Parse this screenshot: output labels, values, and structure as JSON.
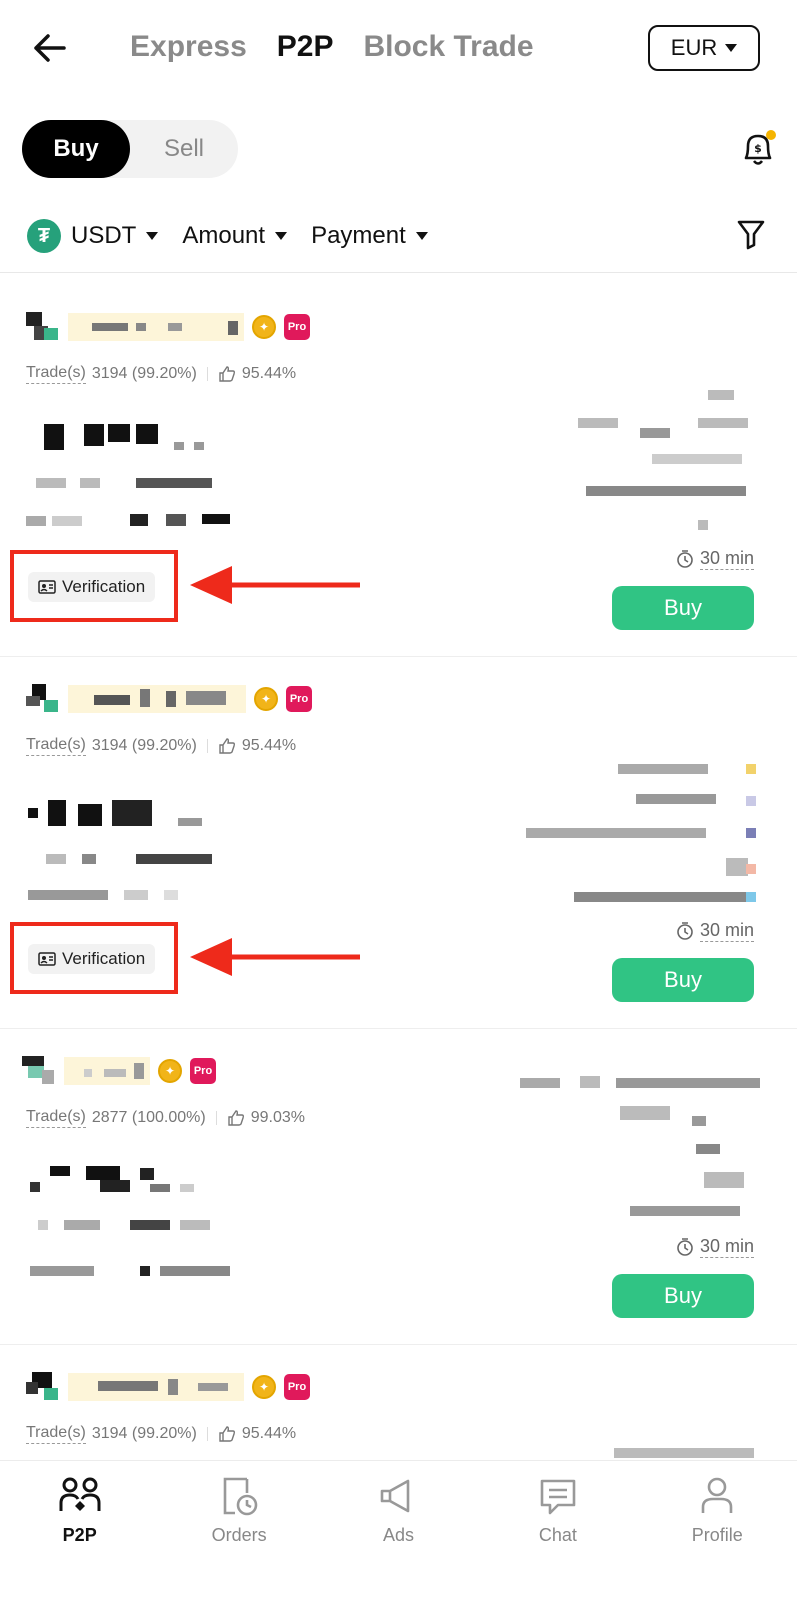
{
  "header": {
    "tabs": [
      "Express",
      "P2P",
      "Block Trade"
    ],
    "active_tab": "P2P",
    "currency": "EUR"
  },
  "toggle": {
    "buy": "Buy",
    "sell": "Sell",
    "active": "Buy"
  },
  "filters": {
    "coin": "USDT",
    "amount": "Amount",
    "payment": "Payment"
  },
  "cards": [
    {
      "trades_label": "Trade(s)",
      "trades": "3194 (99.20%)",
      "rating": "95.44%",
      "time": "30 min",
      "badge": "Verification",
      "buy": "Buy"
    },
    {
      "trades_label": "Trade(s)",
      "trades": "3194 (99.20%)",
      "rating": "95.44%",
      "time": "30 min",
      "badge": "Verification",
      "buy": "Buy"
    },
    {
      "trades_label": "Trade(s)",
      "trades": "2877 (100.00%)",
      "rating": "99.03%",
      "time": "30 min",
      "buy": "Buy"
    },
    {
      "trades_label": "Trade(s)",
      "trades": "3194 (99.20%)",
      "rating": "95.44%"
    }
  ],
  "badges": {
    "pro": "Pro"
  },
  "nav": [
    {
      "label": "P2P",
      "icon": "users-icon",
      "active": true
    },
    {
      "label": "Orders",
      "icon": "orders-clock-icon",
      "active": false
    },
    {
      "label": "Ads",
      "icon": "megaphone-icon",
      "active": false
    },
    {
      "label": "Chat",
      "icon": "chat-icon",
      "active": false
    },
    {
      "label": "Profile",
      "icon": "person-icon",
      "active": false
    }
  ],
  "colors": {
    "buy_button": "#30c484",
    "pro_badge": "#e0195b",
    "annotation": "#ee2a1b",
    "usdt": "#26a17b"
  }
}
